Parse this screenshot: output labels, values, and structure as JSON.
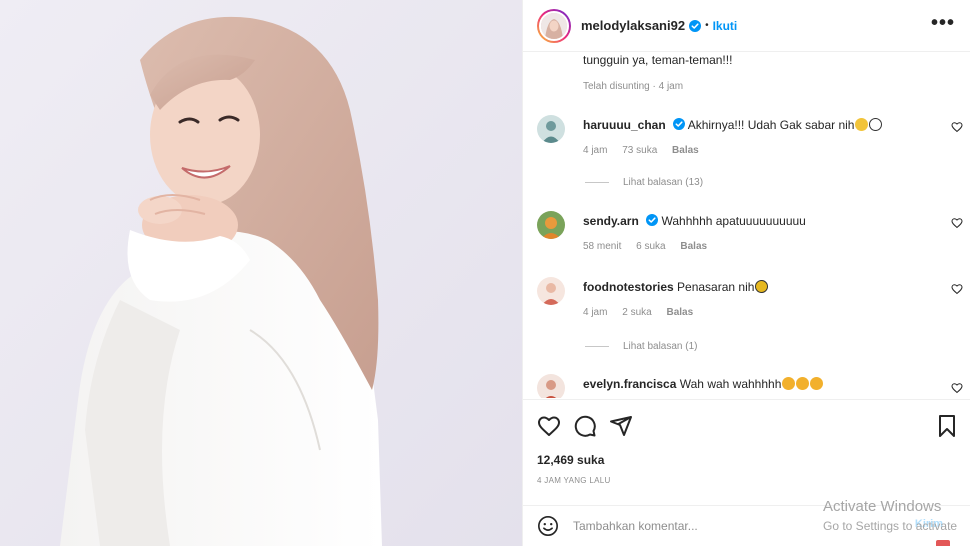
{
  "post": {
    "username": "melodylaksani92",
    "follow_label": "Ikuti",
    "separator": "•",
    "more_label": "•••"
  },
  "caption": {
    "text": "tungguin ya, teman-teman!!!",
    "meta": "Telah disunting · 4 jam"
  },
  "comments": [
    {
      "user": "haruuuu_chan",
      "verified": true,
      "text": "Akhirnya!!! Udah Gak sabar nih",
      "emojis": [
        "smirk-emoji",
        "eyes-emoji"
      ],
      "time": "4 jam",
      "likes": "73 suka",
      "reply": "Balas",
      "view_replies": "Lihat balasan (13)",
      "avatar_color": "#8fb5b8"
    },
    {
      "user": "sendy.arn",
      "verified": true,
      "text": "Wahhhhh apatuuuuuuuuuu",
      "emojis": [],
      "time": "58 menit",
      "likes": "6 suka",
      "reply": "Balas",
      "view_replies": "",
      "avatar_color": "#d98a3f"
    },
    {
      "user": "foodnotestories",
      "verified": false,
      "text": "Penasaran nih",
      "emojis": [
        "bee-emoji"
      ],
      "time": "4 jam",
      "likes": "2 suka",
      "reply": "Balas",
      "view_replies": "Lihat balasan (1)",
      "avatar_color": "#e7b6a6"
    },
    {
      "user": "evelyn.francisca",
      "verified": false,
      "text": "Wah wah wahhhhh",
      "emojis": [
        "heart-eyes-emoji",
        "heart-eyes-emoji",
        "heart-eyes-emoji"
      ],
      "time": "",
      "likes": "",
      "reply": "",
      "view_replies": "",
      "avatar_color": "#c97a6b"
    }
  ],
  "actions": {
    "likes_count": "12,469 suka",
    "time_ago": "4 JAM YANG LALU"
  },
  "add_comment": {
    "placeholder": "Tambahkan komentar...",
    "post_label": "Kirim"
  },
  "windows_watermark": {
    "title": "Activate Windows",
    "subtitle": "Go to Settings to activate"
  },
  "colors": {
    "accent": "#0095f6",
    "text": "#262626",
    "muted": "#8e8e8e",
    "photo_bg": "#e9e7f0",
    "hijab": "#d6b2a3"
  },
  "icons": [
    "verified-badge-icon",
    "more-options-icon",
    "heart-icon",
    "comment-icon",
    "share-icon",
    "bookmark-icon",
    "emoji-icon"
  ]
}
